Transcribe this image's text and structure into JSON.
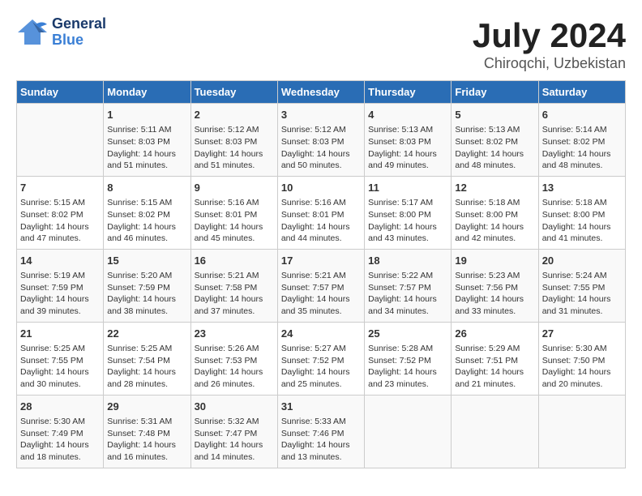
{
  "header": {
    "logo_general": "General",
    "logo_blue": "Blue",
    "main_title": "July 2024",
    "subtitle": "Chiroqchi, Uzbekistan"
  },
  "days_of_week": [
    "Sunday",
    "Monday",
    "Tuesday",
    "Wednesday",
    "Thursday",
    "Friday",
    "Saturday"
  ],
  "weeks": [
    [
      {
        "day": "",
        "content": ""
      },
      {
        "day": "1",
        "content": "Sunrise: 5:11 AM\nSunset: 8:03 PM\nDaylight: 14 hours\nand 51 minutes."
      },
      {
        "day": "2",
        "content": "Sunrise: 5:12 AM\nSunset: 8:03 PM\nDaylight: 14 hours\nand 51 minutes."
      },
      {
        "day": "3",
        "content": "Sunrise: 5:12 AM\nSunset: 8:03 PM\nDaylight: 14 hours\nand 50 minutes."
      },
      {
        "day": "4",
        "content": "Sunrise: 5:13 AM\nSunset: 8:03 PM\nDaylight: 14 hours\nand 49 minutes."
      },
      {
        "day": "5",
        "content": "Sunrise: 5:13 AM\nSunset: 8:02 PM\nDaylight: 14 hours\nand 48 minutes."
      },
      {
        "day": "6",
        "content": "Sunrise: 5:14 AM\nSunset: 8:02 PM\nDaylight: 14 hours\nand 48 minutes."
      }
    ],
    [
      {
        "day": "7",
        "content": "Sunrise: 5:15 AM\nSunset: 8:02 PM\nDaylight: 14 hours\nand 47 minutes."
      },
      {
        "day": "8",
        "content": "Sunrise: 5:15 AM\nSunset: 8:02 PM\nDaylight: 14 hours\nand 46 minutes."
      },
      {
        "day": "9",
        "content": "Sunrise: 5:16 AM\nSunset: 8:01 PM\nDaylight: 14 hours\nand 45 minutes."
      },
      {
        "day": "10",
        "content": "Sunrise: 5:16 AM\nSunset: 8:01 PM\nDaylight: 14 hours\nand 44 minutes."
      },
      {
        "day": "11",
        "content": "Sunrise: 5:17 AM\nSunset: 8:00 PM\nDaylight: 14 hours\nand 43 minutes."
      },
      {
        "day": "12",
        "content": "Sunrise: 5:18 AM\nSunset: 8:00 PM\nDaylight: 14 hours\nand 42 minutes."
      },
      {
        "day": "13",
        "content": "Sunrise: 5:18 AM\nSunset: 8:00 PM\nDaylight: 14 hours\nand 41 minutes."
      }
    ],
    [
      {
        "day": "14",
        "content": "Sunrise: 5:19 AM\nSunset: 7:59 PM\nDaylight: 14 hours\nand 39 minutes."
      },
      {
        "day": "15",
        "content": "Sunrise: 5:20 AM\nSunset: 7:59 PM\nDaylight: 14 hours\nand 38 minutes."
      },
      {
        "day": "16",
        "content": "Sunrise: 5:21 AM\nSunset: 7:58 PM\nDaylight: 14 hours\nand 37 minutes."
      },
      {
        "day": "17",
        "content": "Sunrise: 5:21 AM\nSunset: 7:57 PM\nDaylight: 14 hours\nand 35 minutes."
      },
      {
        "day": "18",
        "content": "Sunrise: 5:22 AM\nSunset: 7:57 PM\nDaylight: 14 hours\nand 34 minutes."
      },
      {
        "day": "19",
        "content": "Sunrise: 5:23 AM\nSunset: 7:56 PM\nDaylight: 14 hours\nand 33 minutes."
      },
      {
        "day": "20",
        "content": "Sunrise: 5:24 AM\nSunset: 7:55 PM\nDaylight: 14 hours\nand 31 minutes."
      }
    ],
    [
      {
        "day": "21",
        "content": "Sunrise: 5:25 AM\nSunset: 7:55 PM\nDaylight: 14 hours\nand 30 minutes."
      },
      {
        "day": "22",
        "content": "Sunrise: 5:25 AM\nSunset: 7:54 PM\nDaylight: 14 hours\nand 28 minutes."
      },
      {
        "day": "23",
        "content": "Sunrise: 5:26 AM\nSunset: 7:53 PM\nDaylight: 14 hours\nand 26 minutes."
      },
      {
        "day": "24",
        "content": "Sunrise: 5:27 AM\nSunset: 7:52 PM\nDaylight: 14 hours\nand 25 minutes."
      },
      {
        "day": "25",
        "content": "Sunrise: 5:28 AM\nSunset: 7:52 PM\nDaylight: 14 hours\nand 23 minutes."
      },
      {
        "day": "26",
        "content": "Sunrise: 5:29 AM\nSunset: 7:51 PM\nDaylight: 14 hours\nand 21 minutes."
      },
      {
        "day": "27",
        "content": "Sunrise: 5:30 AM\nSunset: 7:50 PM\nDaylight: 14 hours\nand 20 minutes."
      }
    ],
    [
      {
        "day": "28",
        "content": "Sunrise: 5:30 AM\nSunset: 7:49 PM\nDaylight: 14 hours\nand 18 minutes."
      },
      {
        "day": "29",
        "content": "Sunrise: 5:31 AM\nSunset: 7:48 PM\nDaylight: 14 hours\nand 16 minutes."
      },
      {
        "day": "30",
        "content": "Sunrise: 5:32 AM\nSunset: 7:47 PM\nDaylight: 14 hours\nand 14 minutes."
      },
      {
        "day": "31",
        "content": "Sunrise: 5:33 AM\nSunset: 7:46 PM\nDaylight: 14 hours\nand 13 minutes."
      },
      {
        "day": "",
        "content": ""
      },
      {
        "day": "",
        "content": ""
      },
      {
        "day": "",
        "content": ""
      }
    ]
  ]
}
